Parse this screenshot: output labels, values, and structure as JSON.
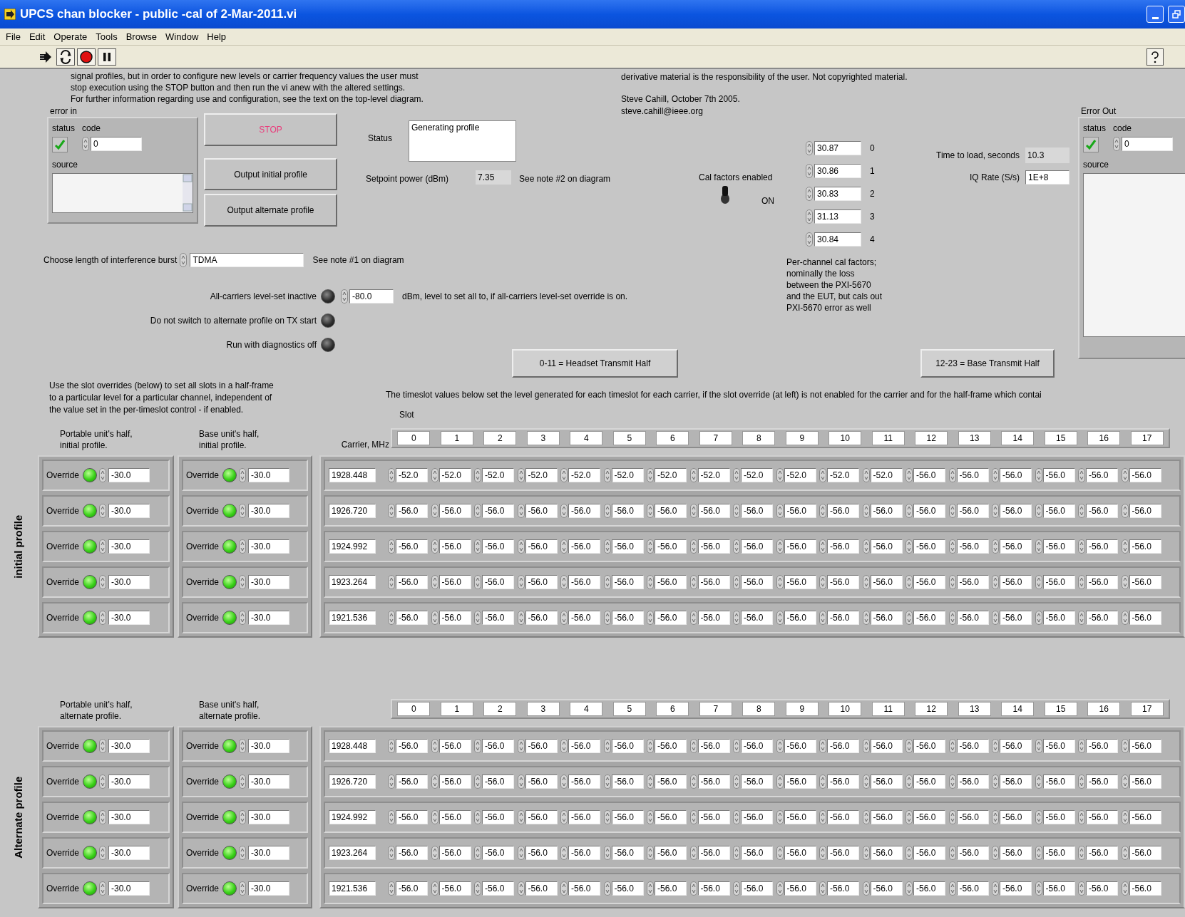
{
  "window": {
    "title": "UPCS chan blocker - public -cal of 2-Mar-2011.vi"
  },
  "menu": [
    "File",
    "Edit",
    "Operate",
    "Tools",
    "Browse",
    "Window",
    "Help"
  ],
  "notes_left": [
    "signal profiles, but in order to configure new levels or carrier frequency values the user must",
    "stop execution using the STOP button and then run the vi anew with the altered settings.",
    "For further information regarding use and configuration, see the text on the top-level diagram."
  ],
  "notes_right": [
    "derivative material is the responsibility of the user. Not copyrighted material.",
    "Steve Cahill, October 7th 2005.",
    "steve.cahill@ieee.org"
  ],
  "error_in": {
    "label": "error in",
    "status_label": "status",
    "status_ok": true,
    "code_label": "code",
    "code": "0",
    "source_label": "source"
  },
  "buttons": [
    {
      "label": "STOP",
      "kind": "stop"
    },
    {
      "label": "Output initial profile",
      "kind": "normal"
    },
    {
      "label": "Output alternate profile",
      "kind": "normal"
    }
  ],
  "status": {
    "label": "Status",
    "value": "Generating profile"
  },
  "setpoint": {
    "label": "Setpoint power (dBm)",
    "value": "7.35",
    "note": "See note #2 on diagram"
  },
  "cal_factors": {
    "label": "Cal factors enabled",
    "on": true,
    "on_text": "ON",
    "values": [
      {
        "value": "30.87",
        "index": "0"
      },
      {
        "value": "30.86",
        "index": "1"
      },
      {
        "value": "30.83",
        "index": "2"
      },
      {
        "value": "31.13",
        "index": "3"
      },
      {
        "value": "30.84",
        "index": "4"
      }
    ],
    "description": [
      "Per-channel cal factors;",
      "nominally the loss",
      "between the PXI-5670",
      "and the EUT, but cals out",
      "PXI-5670 error as well"
    ]
  },
  "time_to_load": {
    "label": "Time to load, seconds",
    "value": "10.3"
  },
  "iq_rate": {
    "label": "IQ Rate (S/s)",
    "value": "1E+8"
  },
  "error_out": {
    "label": "Error Out",
    "status_label": "status",
    "status_ok": true,
    "code_label": "code",
    "code": "0",
    "source_label": "source"
  },
  "burst": {
    "label": "Choose length of interference burst",
    "value": "TDMA",
    "note": "See note  #1 on diagram"
  },
  "indicators": [
    {
      "label": "All-carriers level-set inactive",
      "on": false
    },
    {
      "label": "Do not switch to alternate profile on TX start",
      "on": false
    },
    {
      "label": "Run with diagnostics off",
      "on": false
    }
  ],
  "all_level": {
    "value": "-80.0",
    "note": "dBm, level to set all to, if all-carriers level-set override is on."
  },
  "half_buttons": [
    "0-11 = Headset Transmit Half",
    "12-23 = Base Transmit Half"
  ],
  "override_note": [
    "Use the slot overrides (below) to set all slots in a half-frame",
    "to a particular level for a particular channel, independent of",
    "the value set in the per-timeslot control - if enabled."
  ],
  "timeslot_note": "The timeslot values below set the level generated for each timeslot for each carrier, if the slot override (at left)  is not enabled for the carrier and for the half-frame which contai",
  "slot_label": "Slot",
  "profiles": [
    {
      "title": "initial profile",
      "carrier_label": "Carrier, MHz",
      "portable_label": [
        "Portable unit's half,",
        "initial profile."
      ],
      "base_label": [
        "Base unit's half,",
        "initial profile."
      ],
      "slots": [
        "0",
        "1",
        "2",
        "3",
        "4",
        "5",
        "6",
        "7",
        "8",
        "9",
        "10",
        "11",
        "12",
        "13",
        "14",
        "15",
        "16",
        "17"
      ],
      "rows": [
        {
          "portable": {
            "label": "Override",
            "on": true,
            "value": "-30.0"
          },
          "base": {
            "label": "Override",
            "on": true,
            "value": "-30.0"
          },
          "carrier": "1928.448",
          "values": [
            "-52.0",
            "-52.0",
            "-52.0",
            "-52.0",
            "-52.0",
            "-52.0",
            "-52.0",
            "-52.0",
            "-52.0",
            "-52.0",
            "-52.0",
            "-52.0",
            "-56.0",
            "-56.0",
            "-56.0",
            "-56.0",
            "-56.0",
            "-56.0"
          ]
        },
        {
          "portable": {
            "label": "Override",
            "on": true,
            "value": "-30.0"
          },
          "base": {
            "label": "Override",
            "on": true,
            "value": "-30.0"
          },
          "carrier": "1926.720",
          "values": [
            "-56.0",
            "-56.0",
            "-56.0",
            "-56.0",
            "-56.0",
            "-56.0",
            "-56.0",
            "-56.0",
            "-56.0",
            "-56.0",
            "-56.0",
            "-56.0",
            "-56.0",
            "-56.0",
            "-56.0",
            "-56.0",
            "-56.0",
            "-56.0"
          ]
        },
        {
          "portable": {
            "label": "Override",
            "on": true,
            "value": "-30.0"
          },
          "base": {
            "label": "Override",
            "on": true,
            "value": "-30.0"
          },
          "carrier": "1924.992",
          "values": [
            "-56.0",
            "-56.0",
            "-56.0",
            "-56.0",
            "-56.0",
            "-56.0",
            "-56.0",
            "-56.0",
            "-56.0",
            "-56.0",
            "-56.0",
            "-56.0",
            "-56.0",
            "-56.0",
            "-56.0",
            "-56.0",
            "-56.0",
            "-56.0"
          ]
        },
        {
          "portable": {
            "label": "Override",
            "on": true,
            "value": "-30.0"
          },
          "base": {
            "label": "Override",
            "on": true,
            "value": "-30.0"
          },
          "carrier": "1923.264",
          "values": [
            "-56.0",
            "-56.0",
            "-56.0",
            "-56.0",
            "-56.0",
            "-56.0",
            "-56.0",
            "-56.0",
            "-56.0",
            "-56.0",
            "-56.0",
            "-56.0",
            "-56.0",
            "-56.0",
            "-56.0",
            "-56.0",
            "-56.0",
            "-56.0"
          ]
        },
        {
          "portable": {
            "label": "Override",
            "on": true,
            "value": "-30.0"
          },
          "base": {
            "label": "Override",
            "on": true,
            "value": "-30.0"
          },
          "carrier": "1921.536",
          "values": [
            "-56.0",
            "-56.0",
            "-56.0",
            "-56.0",
            "-56.0",
            "-56.0",
            "-56.0",
            "-56.0",
            "-56.0",
            "-56.0",
            "-56.0",
            "-56.0",
            "-56.0",
            "-56.0",
            "-56.0",
            "-56.0",
            "-56.0",
            "-56.0"
          ]
        }
      ]
    },
    {
      "title": "Alternate profile",
      "portable_label": [
        "Portable unit's half,",
        "alternate profile."
      ],
      "base_label": [
        "Base unit's half,",
        "alternate profile."
      ],
      "slots": [
        "0",
        "1",
        "2",
        "3",
        "4",
        "5",
        "6",
        "7",
        "8",
        "9",
        "10",
        "11",
        "12",
        "13",
        "14",
        "15",
        "16",
        "17"
      ],
      "rows": [
        {
          "portable": {
            "label": "Override",
            "on": true,
            "value": "-30.0"
          },
          "base": {
            "label": "Override",
            "on": true,
            "value": "-30.0"
          },
          "carrier": "1928.448",
          "values": [
            "-56.0",
            "-56.0",
            "-56.0",
            "-56.0",
            "-56.0",
            "-56.0",
            "-56.0",
            "-56.0",
            "-56.0",
            "-56.0",
            "-56.0",
            "-56.0",
            "-56.0",
            "-56.0",
            "-56.0",
            "-56.0",
            "-56.0",
            "-56.0"
          ]
        },
        {
          "portable": {
            "label": "Override",
            "on": true,
            "value": "-30.0"
          },
          "base": {
            "label": "Override",
            "on": true,
            "value": "-30.0"
          },
          "carrier": "1926.720",
          "values": [
            "-56.0",
            "-56.0",
            "-56.0",
            "-56.0",
            "-56.0",
            "-56.0",
            "-56.0",
            "-56.0",
            "-56.0",
            "-56.0",
            "-56.0",
            "-56.0",
            "-56.0",
            "-56.0",
            "-56.0",
            "-56.0",
            "-56.0",
            "-56.0"
          ]
        },
        {
          "portable": {
            "label": "Override",
            "on": true,
            "value": "-30.0"
          },
          "base": {
            "label": "Override",
            "on": true,
            "value": "-30.0"
          },
          "carrier": "1924.992",
          "values": [
            "-56.0",
            "-56.0",
            "-56.0",
            "-56.0",
            "-56.0",
            "-56.0",
            "-56.0",
            "-56.0",
            "-56.0",
            "-56.0",
            "-56.0",
            "-56.0",
            "-56.0",
            "-56.0",
            "-56.0",
            "-56.0",
            "-56.0",
            "-56.0"
          ]
        },
        {
          "portable": {
            "label": "Override",
            "on": true,
            "value": "-30.0"
          },
          "base": {
            "label": "Override",
            "on": true,
            "value": "-30.0"
          },
          "carrier": "1923.264",
          "values": [
            "-56.0",
            "-56.0",
            "-56.0",
            "-56.0",
            "-56.0",
            "-56.0",
            "-56.0",
            "-56.0",
            "-56.0",
            "-56.0",
            "-56.0",
            "-56.0",
            "-56.0",
            "-56.0",
            "-56.0",
            "-56.0",
            "-56.0",
            "-56.0"
          ]
        },
        {
          "portable": {
            "label": "Override",
            "on": true,
            "value": "-30.0"
          },
          "base": {
            "label": "Override",
            "on": true,
            "value": "-30.0"
          },
          "carrier": "1921.536",
          "values": [
            "-56.0",
            "-56.0",
            "-56.0",
            "-56.0",
            "-56.0",
            "-56.0",
            "-56.0",
            "-56.0",
            "-56.0",
            "-56.0",
            "-56.0",
            "-56.0",
            "-56.0",
            "-56.0",
            "-56.0",
            "-56.0",
            "-56.0",
            "-56.0"
          ]
        }
      ]
    }
  ]
}
